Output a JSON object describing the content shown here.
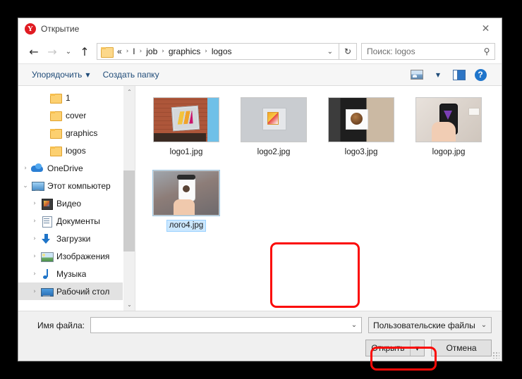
{
  "window": {
    "title": "Открытие",
    "app_icon": "yandex-y-icon",
    "close_label": "✕",
    "accent_red": "#fb0a07"
  },
  "navbar": {
    "back_label": "←",
    "forward_label": "→",
    "recent_label": "⌄",
    "up_label": "↑",
    "breadcrumbs": [
      "«",
      "I",
      "job",
      "graphics",
      "logos"
    ],
    "breadcrumb_separator": "›",
    "dropdown_caret": "⌄",
    "refresh_label": "↻",
    "search_placeholder": "Поиск: logos",
    "search_value": "",
    "search_icon": "magnifier-icon"
  },
  "commandbar": {
    "organize_label": "Упорядочить",
    "organize_caret": "▼",
    "new_folder_label": "Создать папку",
    "view_caret": "▼",
    "view_icon": "view-layout-icon",
    "preview_pane_icon": "preview-pane-icon",
    "help_label": "?"
  },
  "tree": {
    "items": [
      {
        "label": "1",
        "icon": "folder-icon",
        "indent": 2,
        "expander": "",
        "selected": false
      },
      {
        "label": "cover",
        "icon": "folder-icon",
        "indent": 2,
        "expander": "",
        "selected": false
      },
      {
        "label": "graphics",
        "icon": "folder-icon",
        "indent": 2,
        "expander": "",
        "selected": false
      },
      {
        "label": "logos",
        "icon": "folder-icon",
        "indent": 2,
        "expander": "",
        "selected": false
      },
      {
        "label": "OneDrive",
        "icon": "onedrive-cloud-icon",
        "indent": 0,
        "expander": "›",
        "selected": false
      },
      {
        "label": "Этот компьютер",
        "icon": "this-pc-icon",
        "indent": 0,
        "expander": "⌄",
        "selected": false
      },
      {
        "label": "Видео",
        "icon": "videos-icon",
        "indent": 1,
        "expander": "›",
        "selected": false
      },
      {
        "label": "Документы",
        "icon": "documents-icon",
        "indent": 1,
        "expander": "›",
        "selected": false
      },
      {
        "label": "Загрузки",
        "icon": "downloads-icon",
        "indent": 1,
        "expander": "›",
        "selected": false
      },
      {
        "label": "Изображения",
        "icon": "pictures-icon",
        "indent": 1,
        "expander": "›",
        "selected": false
      },
      {
        "label": "Музыка",
        "icon": "music-icon",
        "indent": 1,
        "expander": "›",
        "selected": false
      },
      {
        "label": "Рабочий стол",
        "icon": "desktop-icon",
        "indent": 1,
        "expander": "›",
        "selected": true
      }
    ],
    "scroll_up": "⌃",
    "scroll_down": "⌄"
  },
  "files": [
    {
      "name": "logo1.jpg",
      "thumb": "t1",
      "selected": false,
      "highlighted": false
    },
    {
      "name": "logo2.jpg",
      "thumb": "t2",
      "selected": false,
      "highlighted": false
    },
    {
      "name": "logo3.jpg",
      "thumb": "t3",
      "selected": false,
      "highlighted": false
    },
    {
      "name": "logop.jpg",
      "thumb": "t4",
      "selected": false,
      "highlighted": false
    },
    {
      "name": "лого4.jpg",
      "thumb": "t5",
      "selected": true,
      "highlighted": true
    }
  ],
  "footer": {
    "filename_label": "Имя файла:",
    "filename_value": "",
    "filename_caret": "⌄",
    "filetype_value": "Пользовательские файлы",
    "filetype_caret": "⌄",
    "open_label": "Открыть",
    "open_caret": "▼",
    "cancel_label": "Отмена"
  }
}
